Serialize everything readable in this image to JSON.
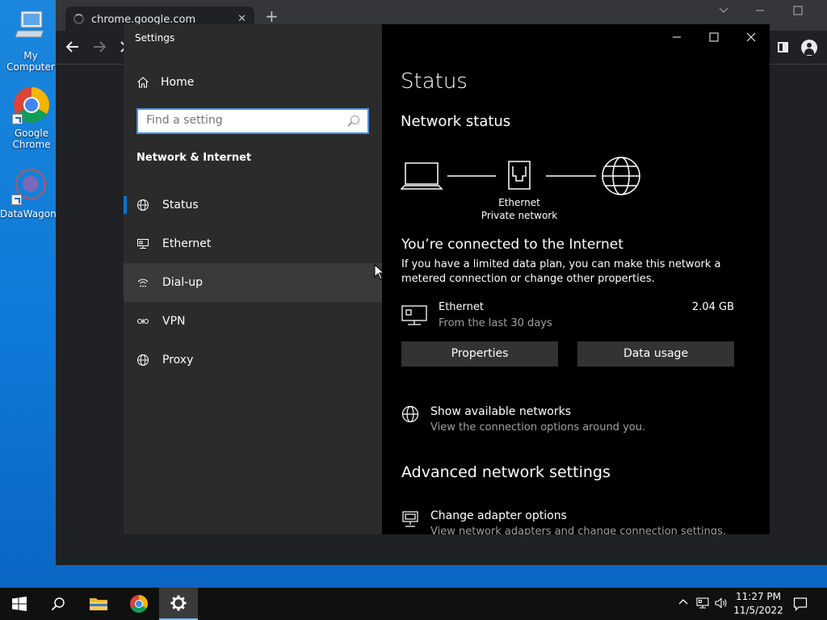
{
  "desktop": {
    "icons": [
      {
        "label": "My Computer"
      },
      {
        "label": "Google Chrome"
      },
      {
        "label": "DataWagon..."
      }
    ]
  },
  "chrome": {
    "tab_title": "chrome.google.com",
    "close_glyph": "✕",
    "new_tab_glyph": "+"
  },
  "settings": {
    "window_title": "Settings",
    "home_label": "Home",
    "search_placeholder": "Find a setting",
    "section_title": "Network & Internet",
    "nav_items": [
      {
        "label": "Status",
        "icon": "globe-icon"
      },
      {
        "label": "Ethernet",
        "icon": "ethernet-icon"
      },
      {
        "label": "Dial-up",
        "icon": "dialup-icon"
      },
      {
        "label": "VPN",
        "icon": "vpn-icon"
      },
      {
        "label": "Proxy",
        "icon": "globe-icon"
      }
    ],
    "page_title": "Status",
    "network_status_title": "Network status",
    "diagram": {
      "adapter_name": "Ethernet",
      "network_type": "Private network"
    },
    "connected_heading": "You’re connected to the Internet",
    "connected_desc": "If you have a limited data plan, you can make this network a metered connection or change other properties.",
    "usage": {
      "name": "Ethernet",
      "period": "From the last 30 days",
      "amount": "2.04 GB"
    },
    "buttons": {
      "properties": "Properties",
      "data_usage": "Data usage"
    },
    "show_networks": {
      "title": "Show available networks",
      "subtitle": "View the connection options around you."
    },
    "advanced_title": "Advanced network settings",
    "adapter_options": {
      "title": "Change adapter options",
      "subtitle": "View network adapters and change connection settings."
    }
  },
  "taskbar": {
    "time": "11:27 PM",
    "date": "11/5/2022"
  },
  "colors": {
    "accent": "#0078d7",
    "nav_bg": "#2b2b2b",
    "content_bg": "#000000",
    "button_bg": "#333333"
  }
}
